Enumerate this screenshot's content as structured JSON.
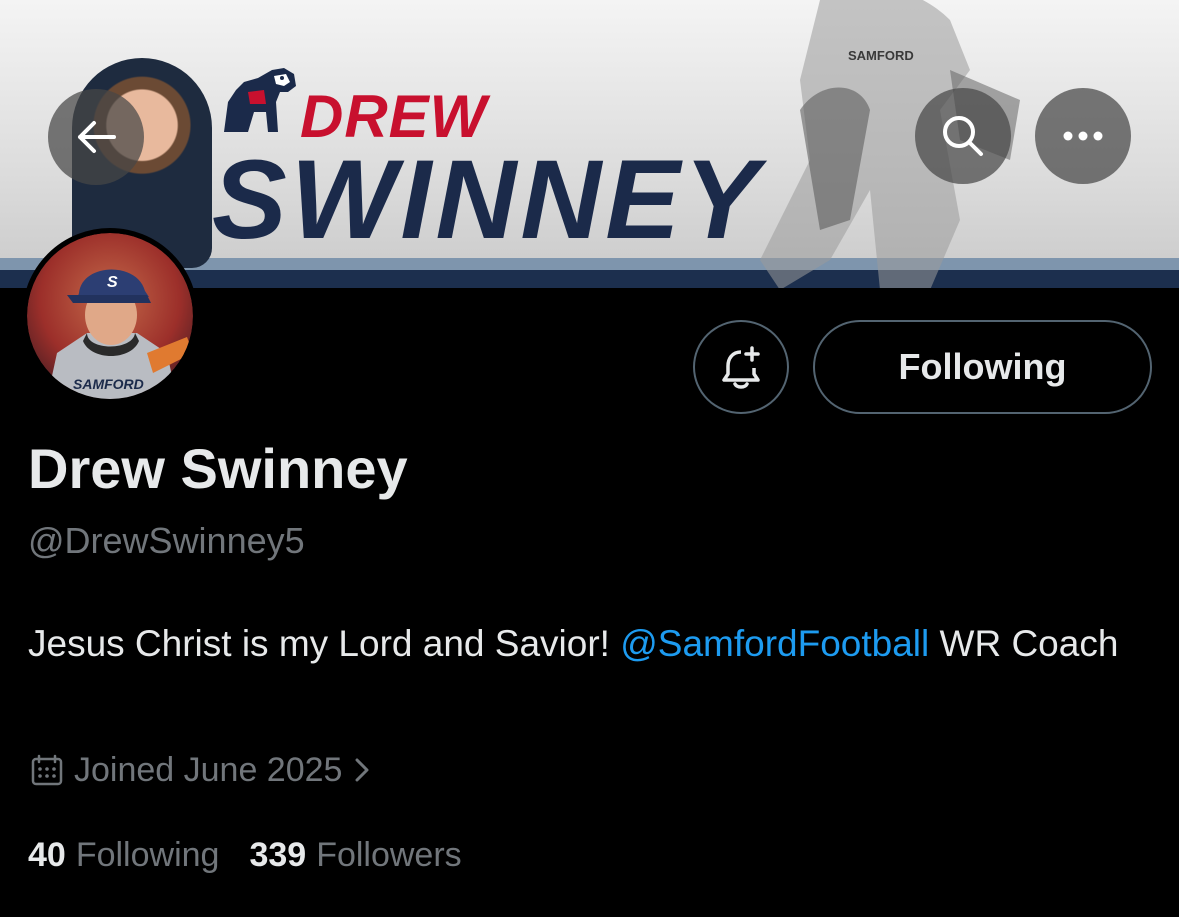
{
  "banner": {
    "first_name": "DREW",
    "last_name": "SWINNEY",
    "shirt_text": "SAMFORD"
  },
  "avatar": {
    "shirt_text": "SAMFORD",
    "cap_letter": "S"
  },
  "toolbar": {
    "back_icon": "arrow-left-icon",
    "search_icon": "search-icon",
    "more_icon": "more-icon"
  },
  "actions": {
    "notify_icon": "bell-plus-icon",
    "following_label": "Following"
  },
  "profile": {
    "display_name": "Drew Swinney",
    "handle": "@DrewSwinney5",
    "bio_text_1": "Jesus Christ is my Lord and Savior! ",
    "bio_mention": "@SamfordFootball",
    "bio_text_2": " WR Coach",
    "joined": "Joined June 2025",
    "joined_icon": "calendar-icon",
    "following_count": "40",
    "following_label": "Following",
    "followers_count": "339",
    "followers_label": "Followers"
  },
  "colors": {
    "background": "#000000",
    "text": "#e7e9ea",
    "muted": "#71767b",
    "link": "#1d9bf0",
    "brand_red": "#c8102e",
    "brand_navy": "#1b2a4a"
  }
}
